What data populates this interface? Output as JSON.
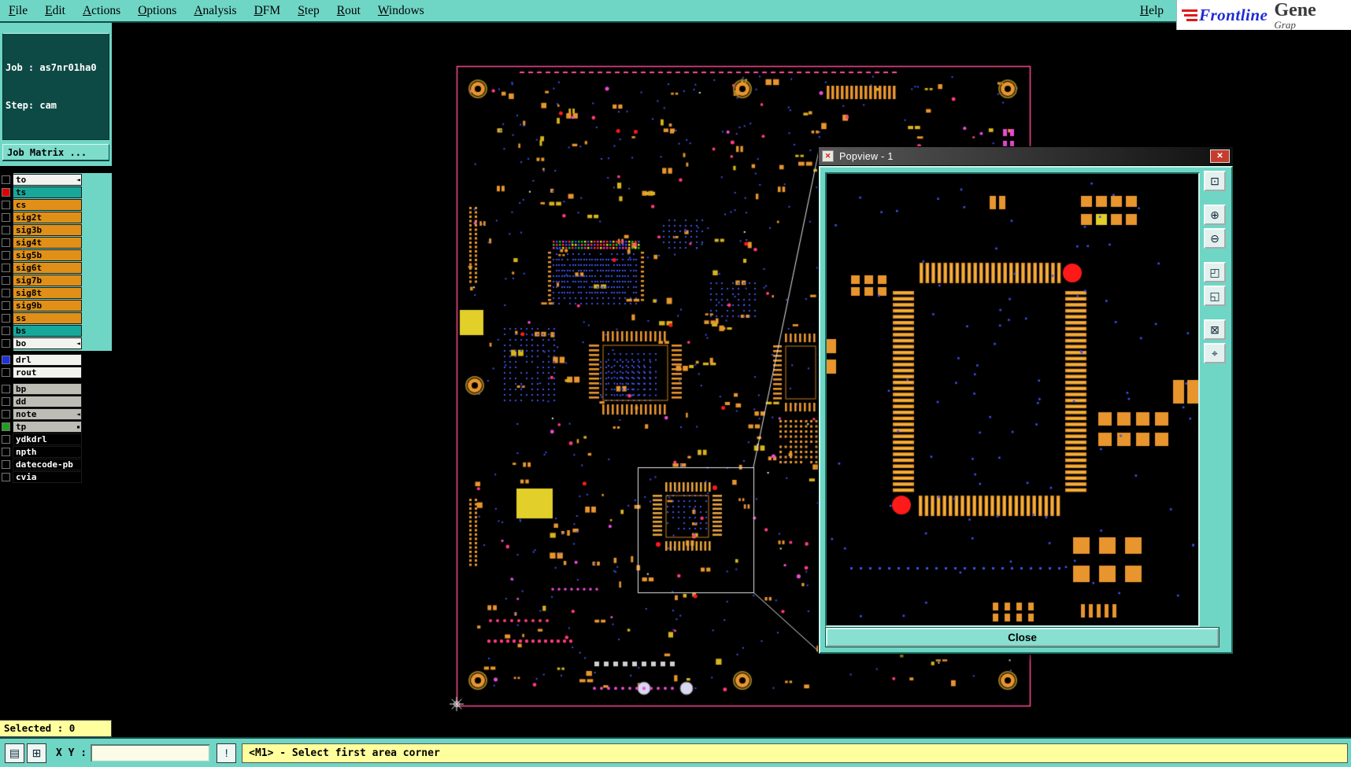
{
  "menu": {
    "items": [
      {
        "label": "File"
      },
      {
        "label": "Edit"
      },
      {
        "label": "Actions"
      },
      {
        "label": "Options"
      },
      {
        "label": "Analysis"
      },
      {
        "label": "DFM"
      },
      {
        "label": "Step"
      },
      {
        "label": "Rout"
      },
      {
        "label": "Windows"
      }
    ],
    "help_label": "Help"
  },
  "logo": {
    "brand": "Frontline",
    "product": "Gene",
    "subtitle": "Grap"
  },
  "sidebar": {
    "job_label": "Job : as7nr01ha0",
    "step_label": "Step: cam",
    "job_matrix_button": "Job Matrix ...",
    "layers": [
      {
        "name": "to",
        "bg": "#f2f2ee",
        "fg": "#000000",
        "suffix": "arrow"
      },
      {
        "name": "ts",
        "bg": "#18a89a",
        "fg": "#000000",
        "check": "#e00000"
      },
      {
        "name": "cs",
        "bg": "#e09018",
        "fg": "#000000"
      },
      {
        "name": "sig2t",
        "bg": "#e09018",
        "fg": "#000000"
      },
      {
        "name": "sig3b",
        "bg": "#e09018",
        "fg": "#000000"
      },
      {
        "name": "sig4t",
        "bg": "#e09018",
        "fg": "#000000"
      },
      {
        "name": "sig5b",
        "bg": "#e09018",
        "fg": "#000000"
      },
      {
        "name": "sig6t",
        "bg": "#e09018",
        "fg": "#000000"
      },
      {
        "name": "sig7b",
        "bg": "#e09018",
        "fg": "#000000"
      },
      {
        "name": "sig8t",
        "bg": "#e09018",
        "fg": "#000000"
      },
      {
        "name": "sig9b",
        "bg": "#e09018",
        "fg": "#000000"
      },
      {
        "name": "ss",
        "bg": "#e09018",
        "fg": "#000000"
      },
      {
        "name": "bs",
        "bg": "#18a89a",
        "fg": "#000000"
      },
      {
        "name": "bo",
        "bg": "#f2f2ee",
        "fg": "#000000",
        "suffix": "arrow"
      },
      {
        "name": "drl",
        "bg": "#f2f2ee",
        "fg": "#000000",
        "check": "#2030e0",
        "gapBefore": true
      },
      {
        "name": "rout",
        "bg": "#f2f2ee",
        "fg": "#000000"
      },
      {
        "name": "bp",
        "bg": "#bdbdb6",
        "fg": "#000000",
        "gapBefore": true
      },
      {
        "name": "dd",
        "bg": "#bdbdb6",
        "fg": "#000000"
      },
      {
        "name": "note",
        "bg": "#bdbdb6",
        "fg": "#000000",
        "suffix": "arrow"
      },
      {
        "name": "tp",
        "bg": "#bdbdb6",
        "fg": "#000000",
        "check": "#20a020",
        "suffix": "dot"
      },
      {
        "name": "ydkdrl",
        "bg": "#000000",
        "fg": "#ffffff"
      },
      {
        "name": "npth",
        "bg": "#000000",
        "fg": "#ffffff"
      },
      {
        "name": "datecode-pb",
        "bg": "#000000",
        "fg": "#ffffff"
      },
      {
        "name": "cvia",
        "bg": "#000000",
        "fg": "#ffffff"
      }
    ]
  },
  "popview": {
    "title": "Popview - 1",
    "icon_glyph": "✕",
    "close_x": "✕",
    "close_button": "Close",
    "tools": [
      {
        "name": "window-icon",
        "glyph": "⊡"
      },
      {
        "name": "scroll-up-icon",
        "glyph": "⊕"
      },
      {
        "name": "scroll-down-icon",
        "glyph": "⊖"
      },
      {
        "name": "pan-left-icon",
        "glyph": "◰"
      },
      {
        "name": "pan-right-icon",
        "glyph": "◱"
      },
      {
        "name": "zoom-box-icon",
        "glyph": "⊠"
      },
      {
        "name": "center-view-icon",
        "glyph": "⌖"
      }
    ]
  },
  "statusbar": {
    "selected_label": "Selected : 0",
    "xy_label": "X Y :",
    "xy_value": "",
    "message": "<M1> - Select first area corner"
  },
  "icons": {
    "notes": "▤",
    "grid": "⊞",
    "prompt": "!"
  },
  "colors": {
    "teal": "#6fd6c6",
    "teal_dark": "#1c6e62",
    "status_yellow": "#ffff9e",
    "panel_header": "#0d4a45",
    "board_outline": "#ff4d94",
    "pad_orange": "#e8952e",
    "pad_gold": "#d9b31e",
    "via_blue": "#3c50e8",
    "pink": "#ff3b7e",
    "magenta": "#e84cd0",
    "highlight_red": "#ff1a1a",
    "yellow_fill": "#e3cf2a",
    "logo_blue": "#1f2bd4",
    "logo_red": "#e01818"
  }
}
